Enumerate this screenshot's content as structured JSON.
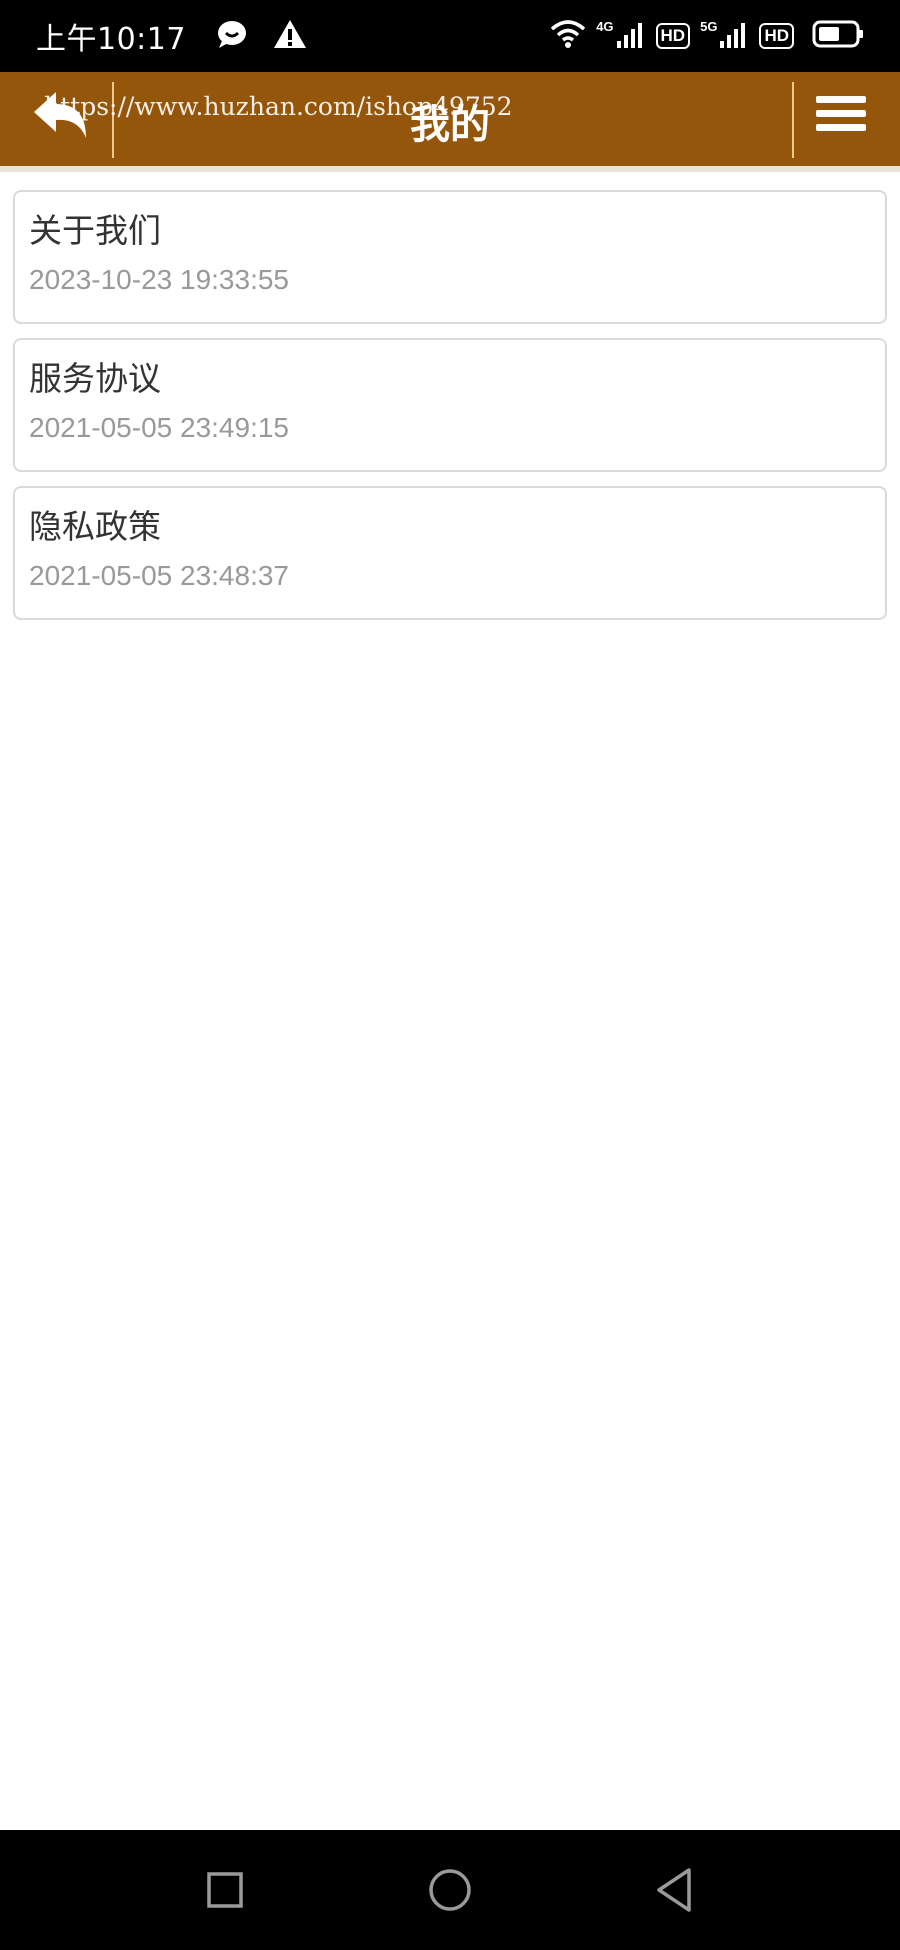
{
  "status_bar": {
    "time": "上午10:17",
    "left_icons": [
      "chat-bubble-icon",
      "warning-icon"
    ],
    "network1": "4G",
    "network2": "5G",
    "hd_label": "HD"
  },
  "header": {
    "title": "我的",
    "watermark": "https://www.huzhan.com/ishop49752",
    "back_icon": "reply-arrow-icon",
    "menu_icon": "hamburger-menu-icon",
    "bg_color": "#93560b"
  },
  "list": {
    "items": [
      {
        "title": "关于我们",
        "date": "2023-10-23 19:33:55"
      },
      {
        "title": "服务协议",
        "date": "2021-05-05 23:49:15"
      },
      {
        "title": "隐私政策",
        "date": "2021-05-05 23:48:37"
      }
    ]
  },
  "nav_bar": {
    "buttons": [
      "recents-square-icon",
      "home-circle-icon",
      "back-triangle-icon"
    ]
  }
}
